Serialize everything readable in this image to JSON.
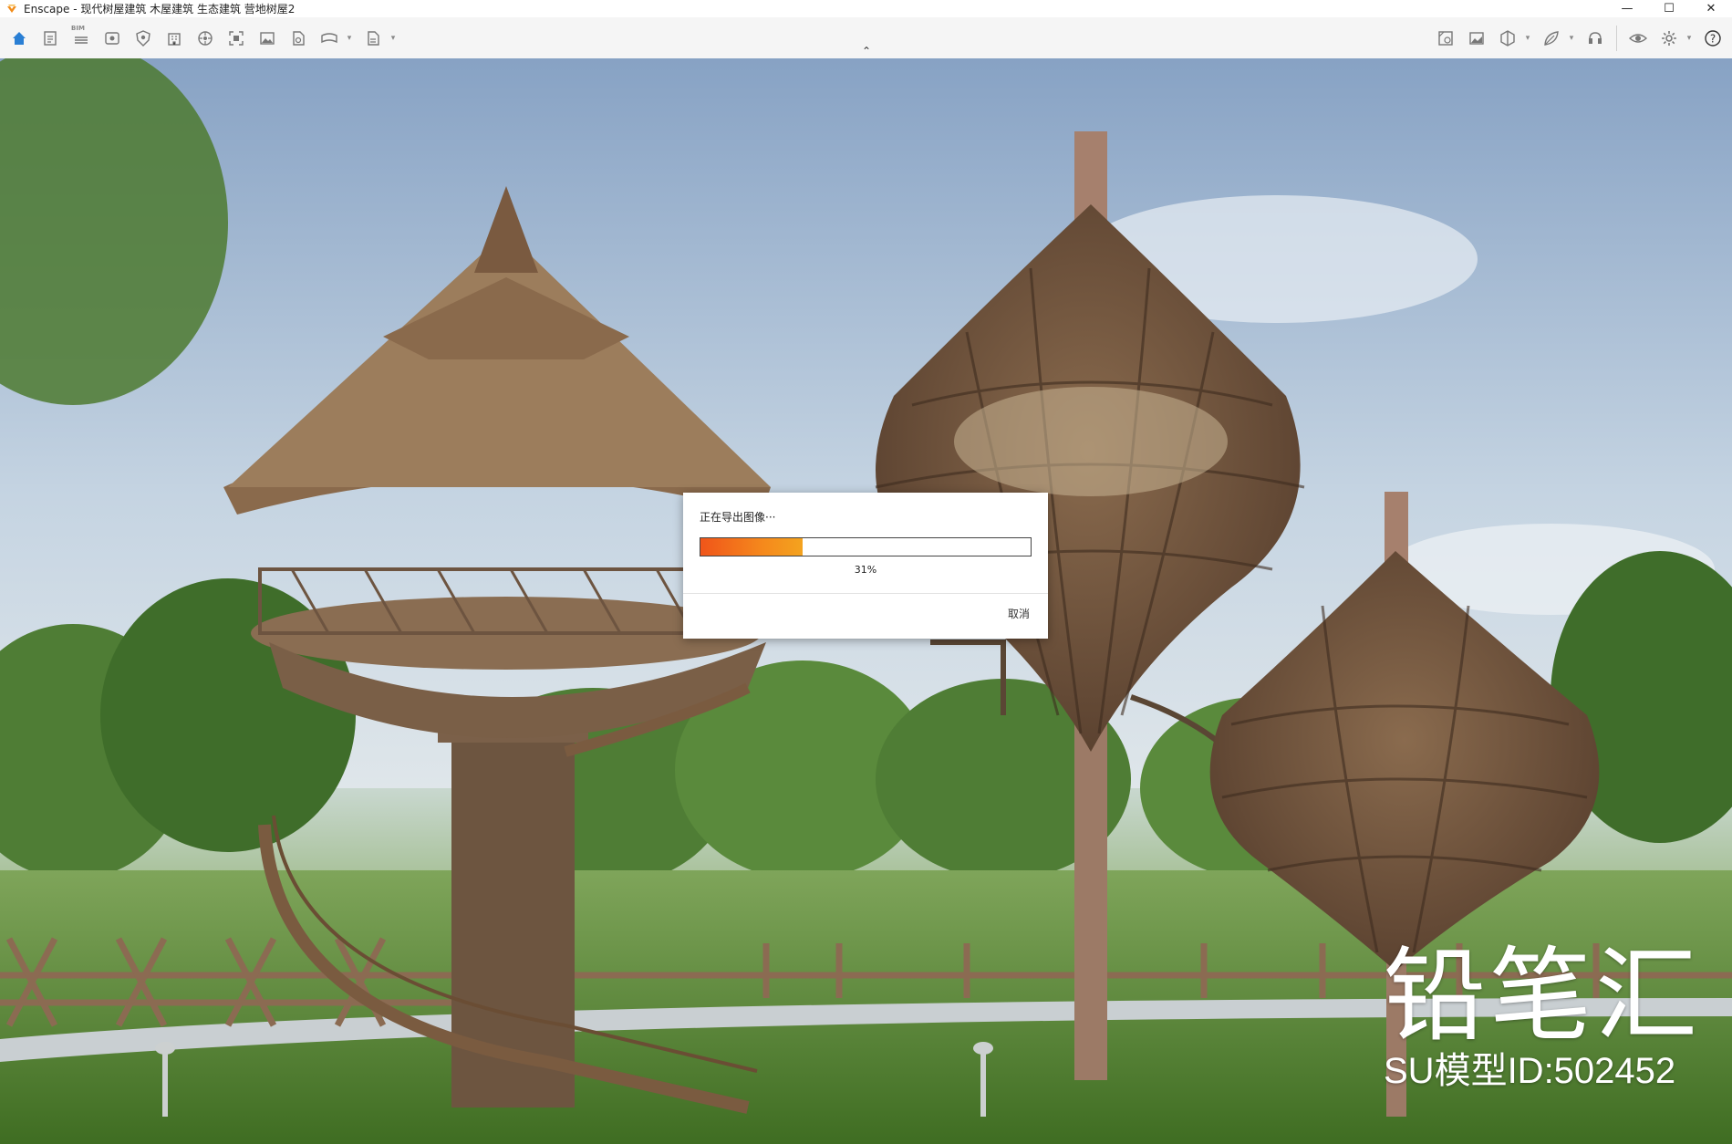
{
  "window": {
    "app_title": "Enscape - 现代树屋建筑 木屋建筑 生态建筑 营地树屋2",
    "minimize_glyph": "—",
    "maximize_glyph": "☐",
    "close_glyph": "✕"
  },
  "toolbar": {
    "left_buttons": [
      {
        "icon": "home-icon"
      },
      {
        "icon": "document-icon"
      },
      {
        "icon": "bim-icon",
        "badge": "BIM"
      },
      {
        "icon": "view-icon"
      },
      {
        "icon": "shield-icon"
      },
      {
        "icon": "building-icon"
      },
      {
        "icon": "asset-icon"
      },
      {
        "icon": "capture-icon"
      },
      {
        "icon": "image-icon"
      },
      {
        "icon": "file-icon"
      },
      {
        "icon": "panorama-export-icon",
        "has_menu": true
      },
      {
        "icon": "exe-export-icon",
        "has_menu": true
      }
    ],
    "collapse_glyph": "⌃",
    "right_buttons": [
      {
        "icon": "map-icon"
      },
      {
        "icon": "picture-icon"
      },
      {
        "icon": "cube-icon",
        "has_menu": true
      },
      {
        "icon": "leaf-icon",
        "has_menu": true
      },
      {
        "icon": "headset-icon"
      },
      {
        "icon": "eye-icon"
      },
      {
        "icon": "settings-icon",
        "has_menu": true
      },
      {
        "icon": "help-icon"
      }
    ]
  },
  "dialog": {
    "title": "正在导出图像···",
    "progress_percent": 31,
    "progress_label": "31%",
    "cancel_label": "取消",
    "accent": "#f0551a"
  },
  "viewport": {
    "watermark_logo": "铅笔汇",
    "watermark_id": "SU模型ID:502452"
  }
}
